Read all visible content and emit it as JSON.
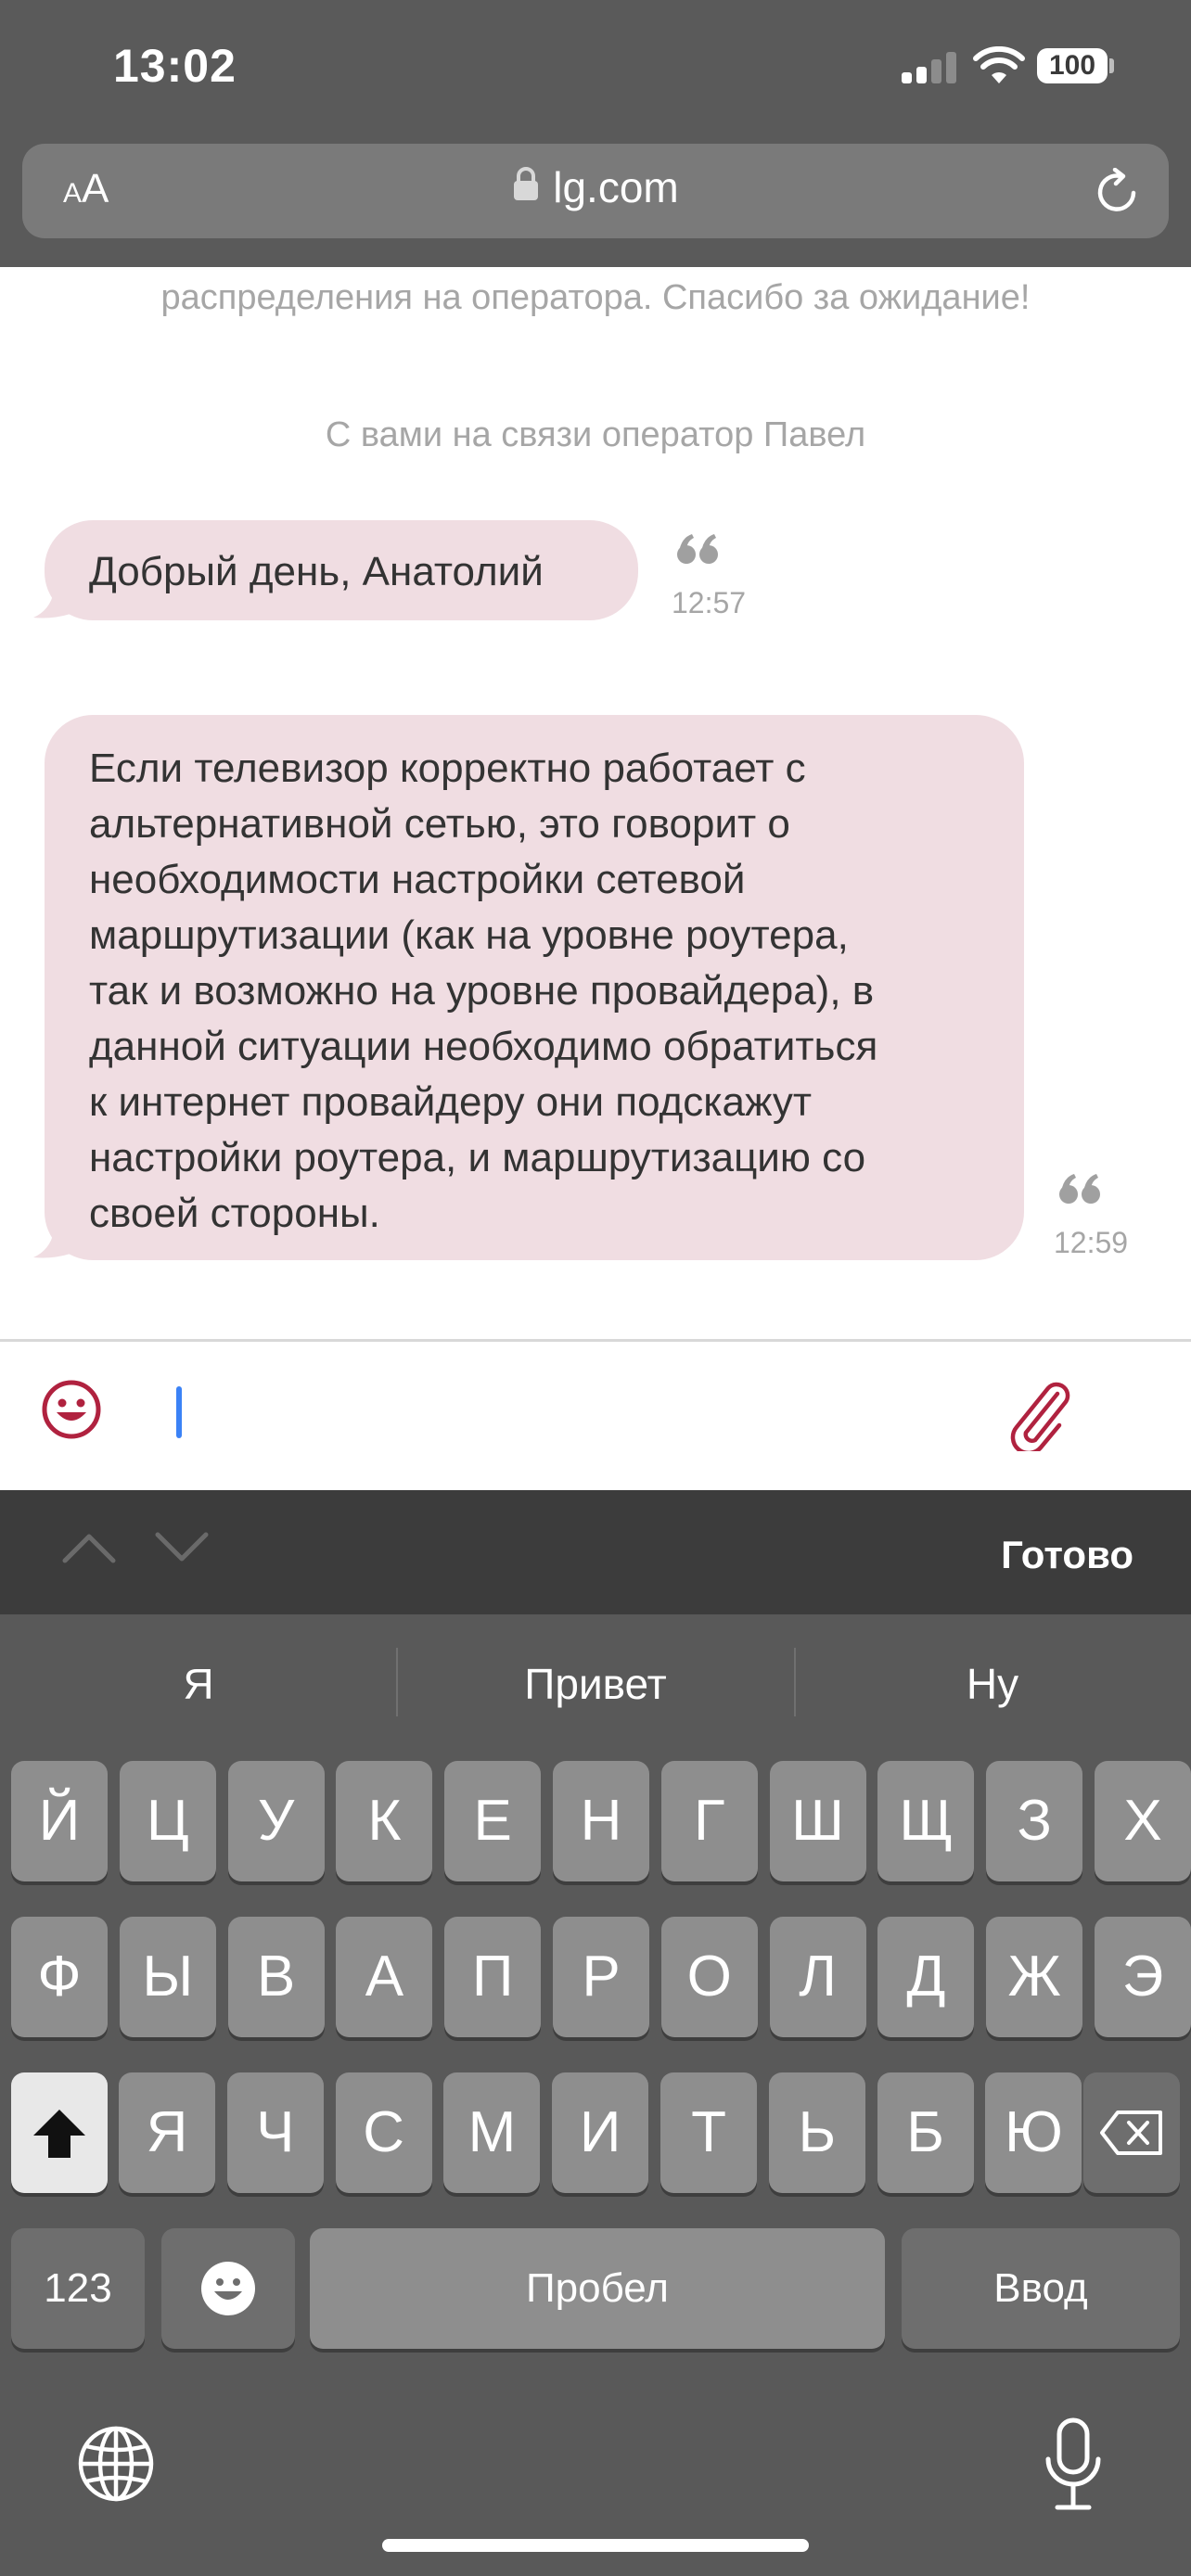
{
  "status_bar": {
    "time": "13:02",
    "battery": "100"
  },
  "browser": {
    "aa_small": "A",
    "aa_big": "A",
    "url": "lg.com"
  },
  "chat": {
    "system_top": "распределения на оператора. Спасибо за ожидание!",
    "operator_line": "С вами на связи оператор Павел",
    "messages": [
      {
        "lines": [
          "Добрый день, Анатолий"
        ],
        "time": "12:57"
      },
      {
        "lines": [
          "Если телевизор корректно работает с",
          "альтернативной сетью, это говорит о",
          "необходимости настройки сетевой",
          "маршрутизации (как на уровне роутера,",
          "так и возможно на уровне провайдера), в",
          "данной ситуации необходимо обратиться",
          "к интернет провайдеру они подскажут",
          "настройки роутера, и маршрутизацию со",
          "своей стороны."
        ],
        "time": "12:59"
      }
    ]
  },
  "accessory": {
    "done": "Готово"
  },
  "keyboard": {
    "suggestions": [
      "Я",
      "Привет",
      "Ну"
    ],
    "row1": [
      "Й",
      "Ц",
      "У",
      "К",
      "Е",
      "Н",
      "Г",
      "Ш",
      "Щ",
      "З",
      "Х"
    ],
    "row2": [
      "Ф",
      "Ы",
      "В",
      "А",
      "П",
      "Р",
      "О",
      "Л",
      "Д",
      "Ж",
      "Э"
    ],
    "row3": [
      "Я",
      "Ч",
      "С",
      "М",
      "И",
      "Т",
      "Ь",
      "Б",
      "Ю"
    ],
    "numbers": "123",
    "space": "Пробел",
    "enter": "Ввод"
  },
  "colors": {
    "accent": "#b0223f",
    "bubble": "#f0dde2",
    "caret": "#3b82f6"
  },
  "icons": [
    "signal-icon",
    "wifi-icon",
    "battery-icon",
    "lock-icon",
    "reload-icon",
    "quote-icon",
    "smile-icon",
    "paperclip-icon",
    "chevron-up-icon",
    "chevron-down-icon",
    "shift-icon",
    "backspace-icon",
    "emoji-icon",
    "globe-icon",
    "mic-icon"
  ]
}
